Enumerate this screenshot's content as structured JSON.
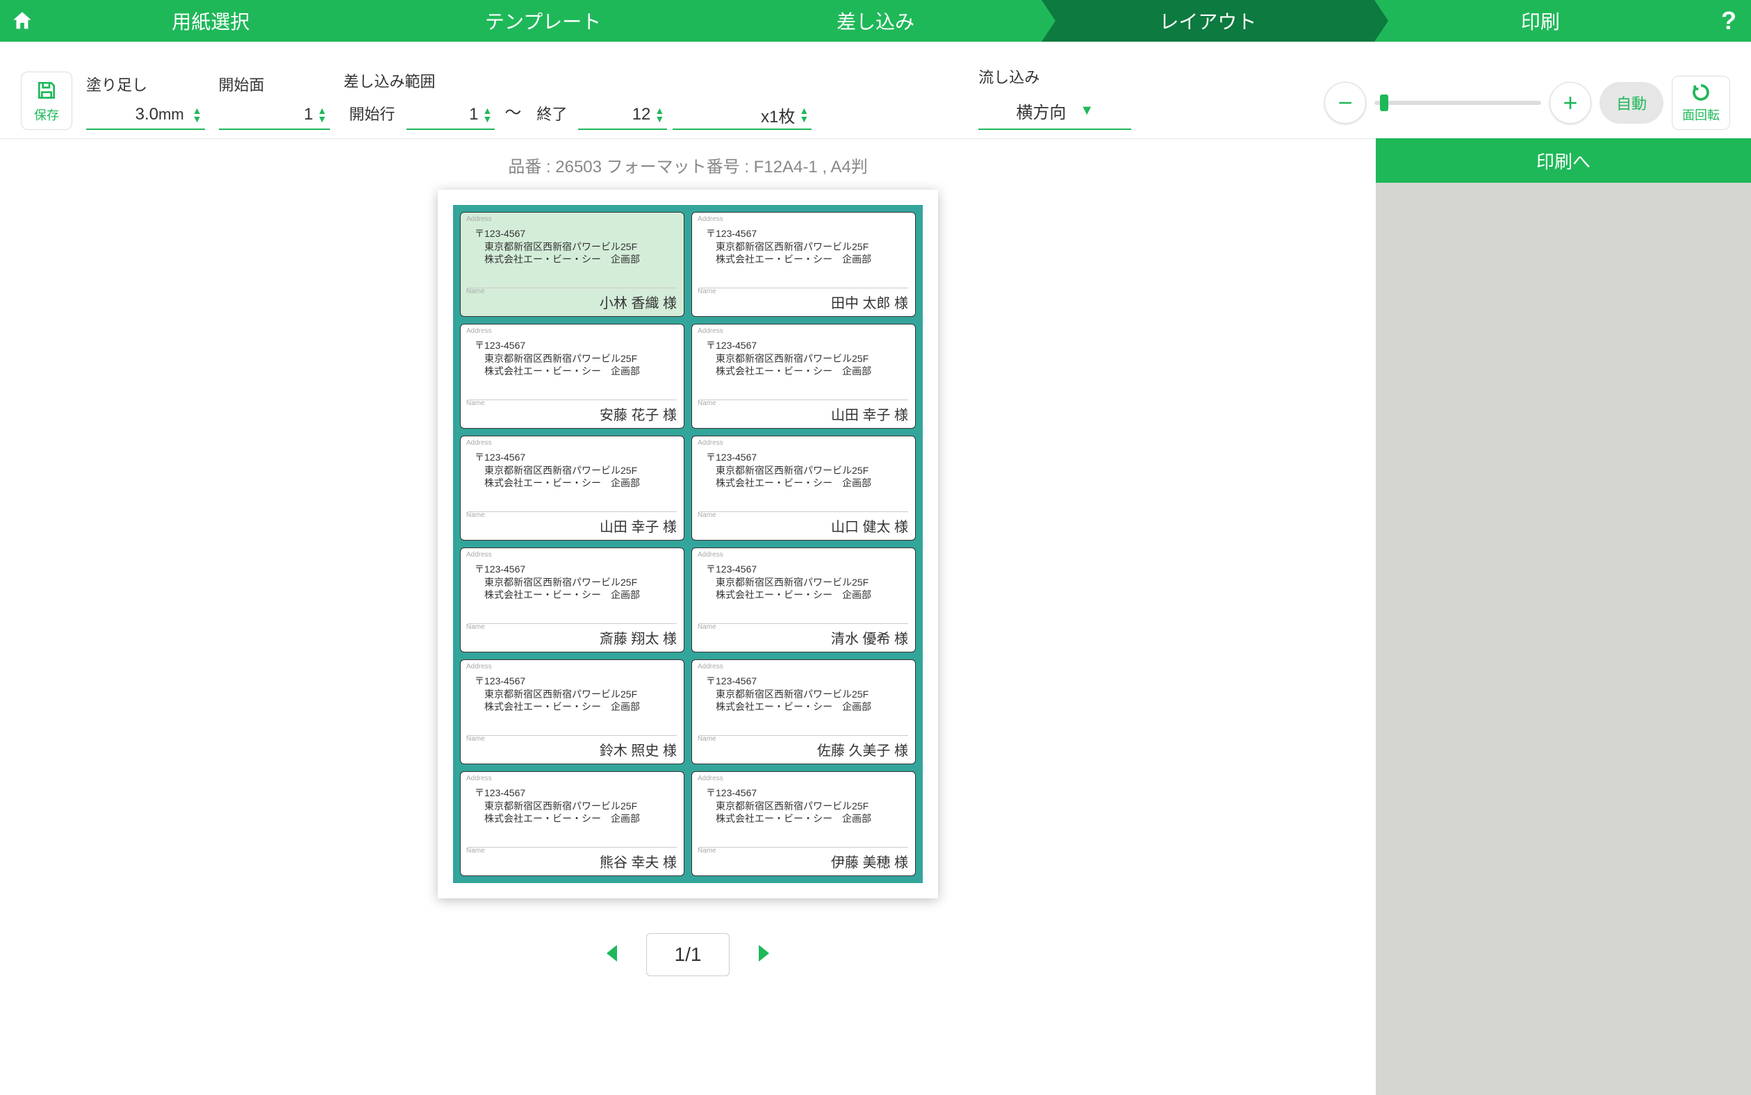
{
  "header": {
    "steps": [
      "用紙選択",
      "テンプレート",
      "差し込み",
      "レイアウト",
      "印刷"
    ],
    "active_index": 3,
    "help": "?"
  },
  "toolbar": {
    "save_label": "保存",
    "bleed": {
      "label": "塗り足し",
      "value": "3.0",
      "unit": "mm"
    },
    "start_face": {
      "label": "開始面",
      "value": "1"
    },
    "range": {
      "label": "差し込み範囲",
      "start_label": "開始行",
      "start_value": "1",
      "tilde": "～",
      "end_label": "終了",
      "end_value": "12",
      "copies": "x1枚"
    },
    "flow": {
      "label": "流し込み",
      "value": "横方向"
    },
    "auto": "自動",
    "rotate": "面回転"
  },
  "meta": "品番 : 26503 フォーマット番号 : F12A4-1 , A4判",
  "common": {
    "address_lbl": "Address",
    "name_lbl": "Name",
    "zip": "〒123-4567",
    "addr1": "東京都新宿区西新宿パワービル25F",
    "addr2": "株式会社エー・ビー・シー　企画部"
  },
  "cells": [
    {
      "name": "小林 香織 様",
      "selected": true
    },
    {
      "name": "田中 太郎 様"
    },
    {
      "name": "安藤 花子 様"
    },
    {
      "name": "山田 幸子 様"
    },
    {
      "name": "山田 幸子 様"
    },
    {
      "name": "山口 健太 様"
    },
    {
      "name": "斎藤 翔太 様"
    },
    {
      "name": "清水 優希 様"
    },
    {
      "name": "鈴木 照史 様"
    },
    {
      "name": "佐藤 久美子 様"
    },
    {
      "name": "熊谷 幸夫 様"
    },
    {
      "name": "伊藤 美穂 様"
    }
  ],
  "pager": {
    "text": "1/1"
  },
  "side": {
    "print": "印刷へ"
  }
}
